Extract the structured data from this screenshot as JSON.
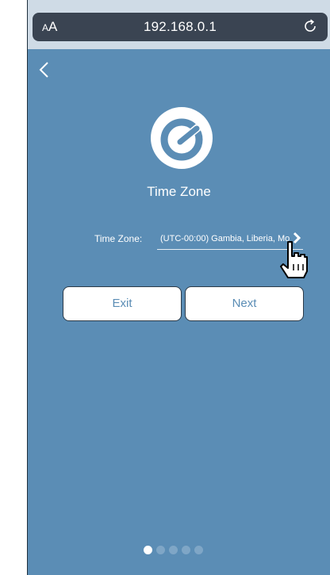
{
  "browser": {
    "text_size_label_small": "A",
    "text_size_label_large": "A",
    "url": "192.168.0.1"
  },
  "page": {
    "title": "Time Zone",
    "timezone_label": "Time Zone:",
    "timezone_value": "(UTC-00:00) Gambia, Liberia, Mo",
    "exit_label": "Exit",
    "next_label": "Next"
  },
  "pager": {
    "total": 5,
    "current": 1
  },
  "colors": {
    "background": "#5b8db5",
    "address_bar": "#3a4452",
    "button_text": "#5b8db5"
  }
}
